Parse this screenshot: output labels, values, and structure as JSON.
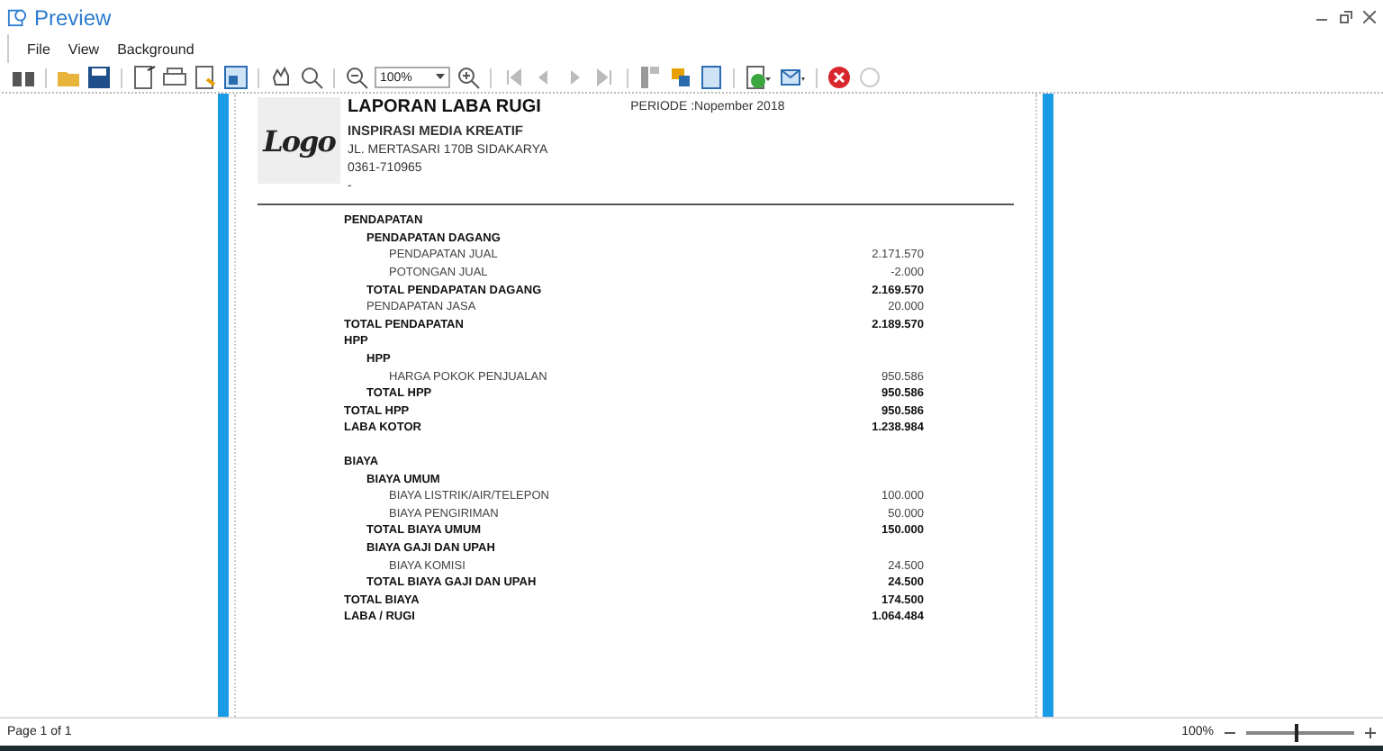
{
  "window": {
    "title": "Preview"
  },
  "menu": [
    "File",
    "View",
    "Background"
  ],
  "toolbar": {
    "zoom_value": "100%"
  },
  "report": {
    "logo_text": "Logo",
    "title": "LAPORAN LABA RUGI",
    "company": "INSPIRASI MEDIA KREATIF",
    "address": "JL. MERTASARI 170B SIDAKARYA",
    "phone": "0361-710965",
    "extra": "-",
    "period": "PERIODE :Nopember 2018",
    "sections": [
      [
        {
          "label": "PENDAPATAN",
          "children": [
            {
              "label": "PENDAPATAN DAGANG",
              "children": [
                {
                  "kind": "item",
                  "label": "PENDAPATAN JUAL",
                  "value": "2.171.570"
                },
                {
                  "kind": "item",
                  "label": "POTONGAN JUAL",
                  "value": "-2.000"
                }
              ]
            },
            {
              "kind": "total",
              "label": "TOTAL PENDAPATAN DAGANG",
              "value": "2.169.570"
            },
            {
              "kind": "item",
              "label": "PENDAPATAN JASA",
              "value": "20.000"
            }
          ]
        },
        {
          "kind": "total",
          "label": "TOTAL PENDAPATAN",
          "value": "2.189.570"
        },
        {
          "label": "HPP",
          "children": [
            {
              "label": "HPP",
              "children": [
                {
                  "kind": "item",
                  "label": "HARGA POKOK PENJUALAN",
                  "value": "950.586"
                }
              ]
            },
            {
              "kind": "total",
              "label": "TOTAL HPP",
              "value": "950.586"
            }
          ]
        },
        {
          "kind": "total",
          "label": "TOTAL HPP",
          "value": "950.586"
        },
        {
          "kind": "total",
          "label": "LABA KOTOR",
          "value": "1.238.984"
        }
      ],
      [
        {
          "label": "BIAYA",
          "children": [
            {
              "label": "BIAYA UMUM",
              "children": [
                {
                  "kind": "item",
                  "label": "BIAYA LISTRIK/AIR/TELEPON",
                  "value": "100.000"
                },
                {
                  "kind": "item",
                  "label": "BIAYA PENGIRIMAN",
                  "value": "50.000"
                }
              ]
            },
            {
              "kind": "total",
              "label": "TOTAL BIAYA UMUM",
              "value": "150.000"
            },
            {
              "label": "BIAYA GAJI DAN UPAH",
              "children": [
                {
                  "kind": "item",
                  "label": "BIAYA KOMISI",
                  "value": "24.500"
                }
              ]
            },
            {
              "kind": "total",
              "label": "TOTAL BIAYA GAJI DAN UPAH",
              "value": "24.500"
            }
          ]
        },
        {
          "kind": "total",
          "label": "TOTAL BIAYA",
          "value": "174.500"
        },
        {
          "kind": "total",
          "label": "LABA / RUGI",
          "value": "1.064.484"
        }
      ]
    ]
  },
  "status_bar": {
    "page": "Page 1 of 1",
    "zoom": "100%",
    "zoom_slider": {
      "level": 0.45
    }
  }
}
